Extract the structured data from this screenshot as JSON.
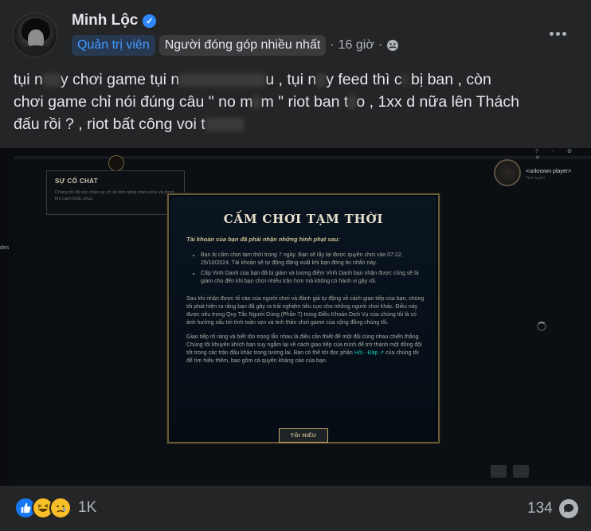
{
  "post": {
    "author": "Minh Lộc",
    "badge_admin": "Quản trị viên",
    "badge_contributor": "Người đóng góp nhiều nhất",
    "separator": "·",
    "time": "16 giờ",
    "text_line1_a": "tụi n",
    "text_line1_b": "y chơi game tụi n",
    "text_line1_c": "u , tụi n",
    "text_line1_d": "y feed thì c",
    "text_line1_e": " bị ban , còn",
    "text_line2_a": "chơi game chỉ nói đúng câu \" no m",
    "text_line2_b": "m \" riot ban t",
    "text_line2_c": "o , 1xx d nữa lên Thách",
    "text_line3": "đấu rồi ? , riot bất công voi t"
  },
  "game": {
    "issue_title": "SỰ CỐ CHAT",
    "issue_text": "Chúng tôi đã xác nhận sự cố về tính năng chat voice và đang tìm cách khắc phục.",
    "side_label": "des",
    "window_controls": "? − ⚙ ✕",
    "player_name": "<unknown player>",
    "player_status": "Trực tuyến",
    "modal": {
      "title": "CẤM CHƠI TẠM THỜI",
      "heading": "Tài khoản của bạn đã phải nhận những hình phạt sau:",
      "bullet1": "Bạn bị cấm chơi tạm thời trong 7 ngày. Bạn sẽ lấy lại được quyền chơi vào 07:22, 25/10/2024. Tài khoản sẽ tự động đăng xuất khi bạn đóng tin nhắn này.",
      "bullet2": "Cấp Vinh Danh của bạn đã bị giảm và lượng điểm Vinh Danh bạn nhận được cũng sẽ bị giảm cho đến khi bạn chơi nhiều trận hơn mà không có hành vi gây rối.",
      "para1": "Sau khi nhận được tố cáo của người chơi và đánh giá tự động về cách giao tiếp của bạn, chúng tôi phát hiện ra rằng bạn đã gây ra trải nghiệm tiêu cực cho những người chơi khác. Điều này được nêu trong Quy Tắc Người Dùng (Phần 7) trong Điều Khoản Dịch Vụ của chúng tôi là có ảnh hưởng xấu tới tính toàn vẹn và tinh thần chơi game của cộng đồng chúng tôi.",
      "para2_a": "Giao tiếp rõ ràng và biết tôn trọng lẫn nhau là điều cần thiết để một đội cùng nhau chiến thắng. Chúng tôi khuyến khích bạn suy ngẫm lại về cách giao tiếp của mình để trở thành một đồng đội tốt trong các trận đấu khác trong tương lai. Bạn có thể tới đọc phần ",
      "para2_link": "Hỏi - Đáp ↗",
      "para2_b": " của chúng tôi để tìm hiểu thêm, bao gồm cả quyền kháng cáo của bạn.",
      "button": "TÔI HIỂU"
    }
  },
  "footer": {
    "reaction_count": "1K",
    "comment_count": "134"
  },
  "colors": {
    "background": "#242526",
    "accent_blue": "#4599ff",
    "league_gold": "#c8aa6e"
  },
  "icons": [
    "verified-icon",
    "globe-icon",
    "more-icon",
    "like-icon",
    "haha-icon",
    "care-icon",
    "comment-icon"
  ]
}
